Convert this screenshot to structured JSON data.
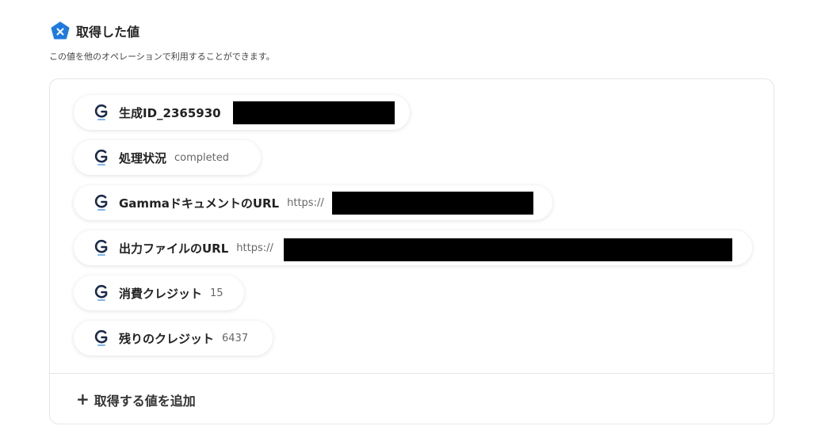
{
  "header": {
    "badge_icon": "x-pentagon-icon",
    "badge_color": "#1f7ae0",
    "title": "取得した値",
    "subtitle": "この値を他のオペレーションで利用することができます。"
  },
  "items": [
    {
      "label": "生成ID_2365930",
      "value": "",
      "icon": "gamma-g-icon"
    },
    {
      "label": "処理状況",
      "value": "completed",
      "icon": "gamma-g-icon"
    },
    {
      "label": "GammaドキュメントのURL",
      "value": "https://",
      "icon": "gamma-g-icon"
    },
    {
      "label": "出力ファイルのURL",
      "value": "https://",
      "icon": "gamma-g-icon"
    },
    {
      "label": "消費クレジット",
      "value": "15",
      "icon": "gamma-g-icon"
    },
    {
      "label": "残りのクレジット",
      "value": "6437",
      "icon": "gamma-g-icon"
    }
  ],
  "add_button": {
    "icon": "plus-icon",
    "label": "取得する値を追加"
  }
}
